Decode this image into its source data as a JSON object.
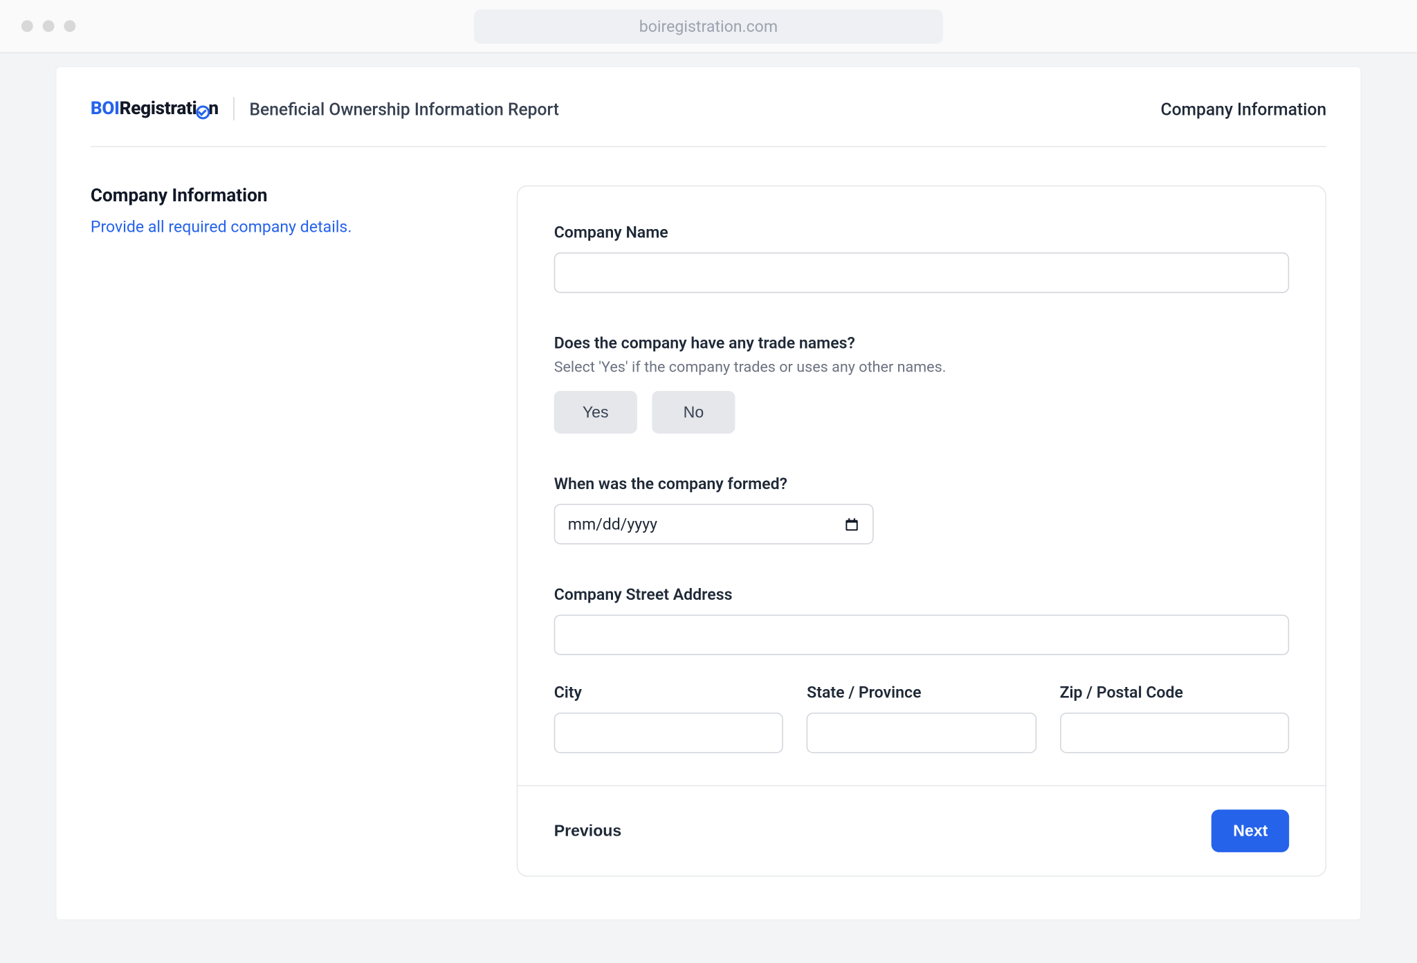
{
  "browser": {
    "url": "boiregistration.com"
  },
  "header": {
    "logo_prefix": "BOI",
    "logo_suffix_pre": "Registrati",
    "logo_suffix_post": "n",
    "report_title": "Beneficial Ownership Information Report",
    "page_name": "Company Information"
  },
  "sidebar": {
    "title": "Company Information",
    "subtitle": "Provide all required company details."
  },
  "form": {
    "company_name": {
      "label": "Company Name",
      "value": ""
    },
    "trade_names": {
      "label": "Does the company have any trade names?",
      "hint": "Select 'Yes' if the company trades or uses any other names.",
      "yes": "Yes",
      "no": "No"
    },
    "date_formed": {
      "label": "When was the company formed?",
      "placeholder": "mm/dd/yyyy"
    },
    "street": {
      "label": "Company Street Address",
      "value": ""
    },
    "city": {
      "label": "City",
      "value": ""
    },
    "state": {
      "label": "State / Province",
      "value": ""
    },
    "zip": {
      "label": "Zip / Postal Code",
      "value": ""
    }
  },
  "footer": {
    "previous": "Previous",
    "next": "Next"
  }
}
